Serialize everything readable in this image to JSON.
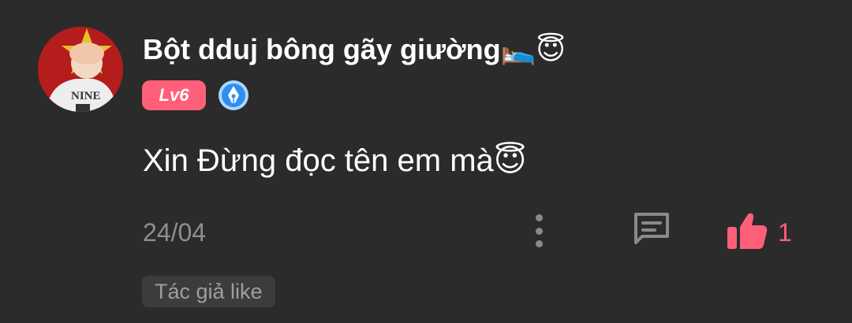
{
  "comment": {
    "username": "Bột dduj bông gãy giường",
    "username_emojis": "🛌😇",
    "level": "Lv6",
    "text": "Xin Đừng đọc tên em mà",
    "text_emoji": "😇",
    "date": "24/04",
    "like_count": "1",
    "author_liked_label": "Tác giả like",
    "avatar_shirt_text": "NINE"
  },
  "colors": {
    "background": "#2b2b2b",
    "accent": "#ff5f78",
    "muted": "#8e8e8e"
  },
  "icons": {
    "more": "more-vertical-icon",
    "reply": "comment-icon",
    "like": "thumbs-up-icon",
    "author_badge": "pen-nib-badge-icon"
  }
}
